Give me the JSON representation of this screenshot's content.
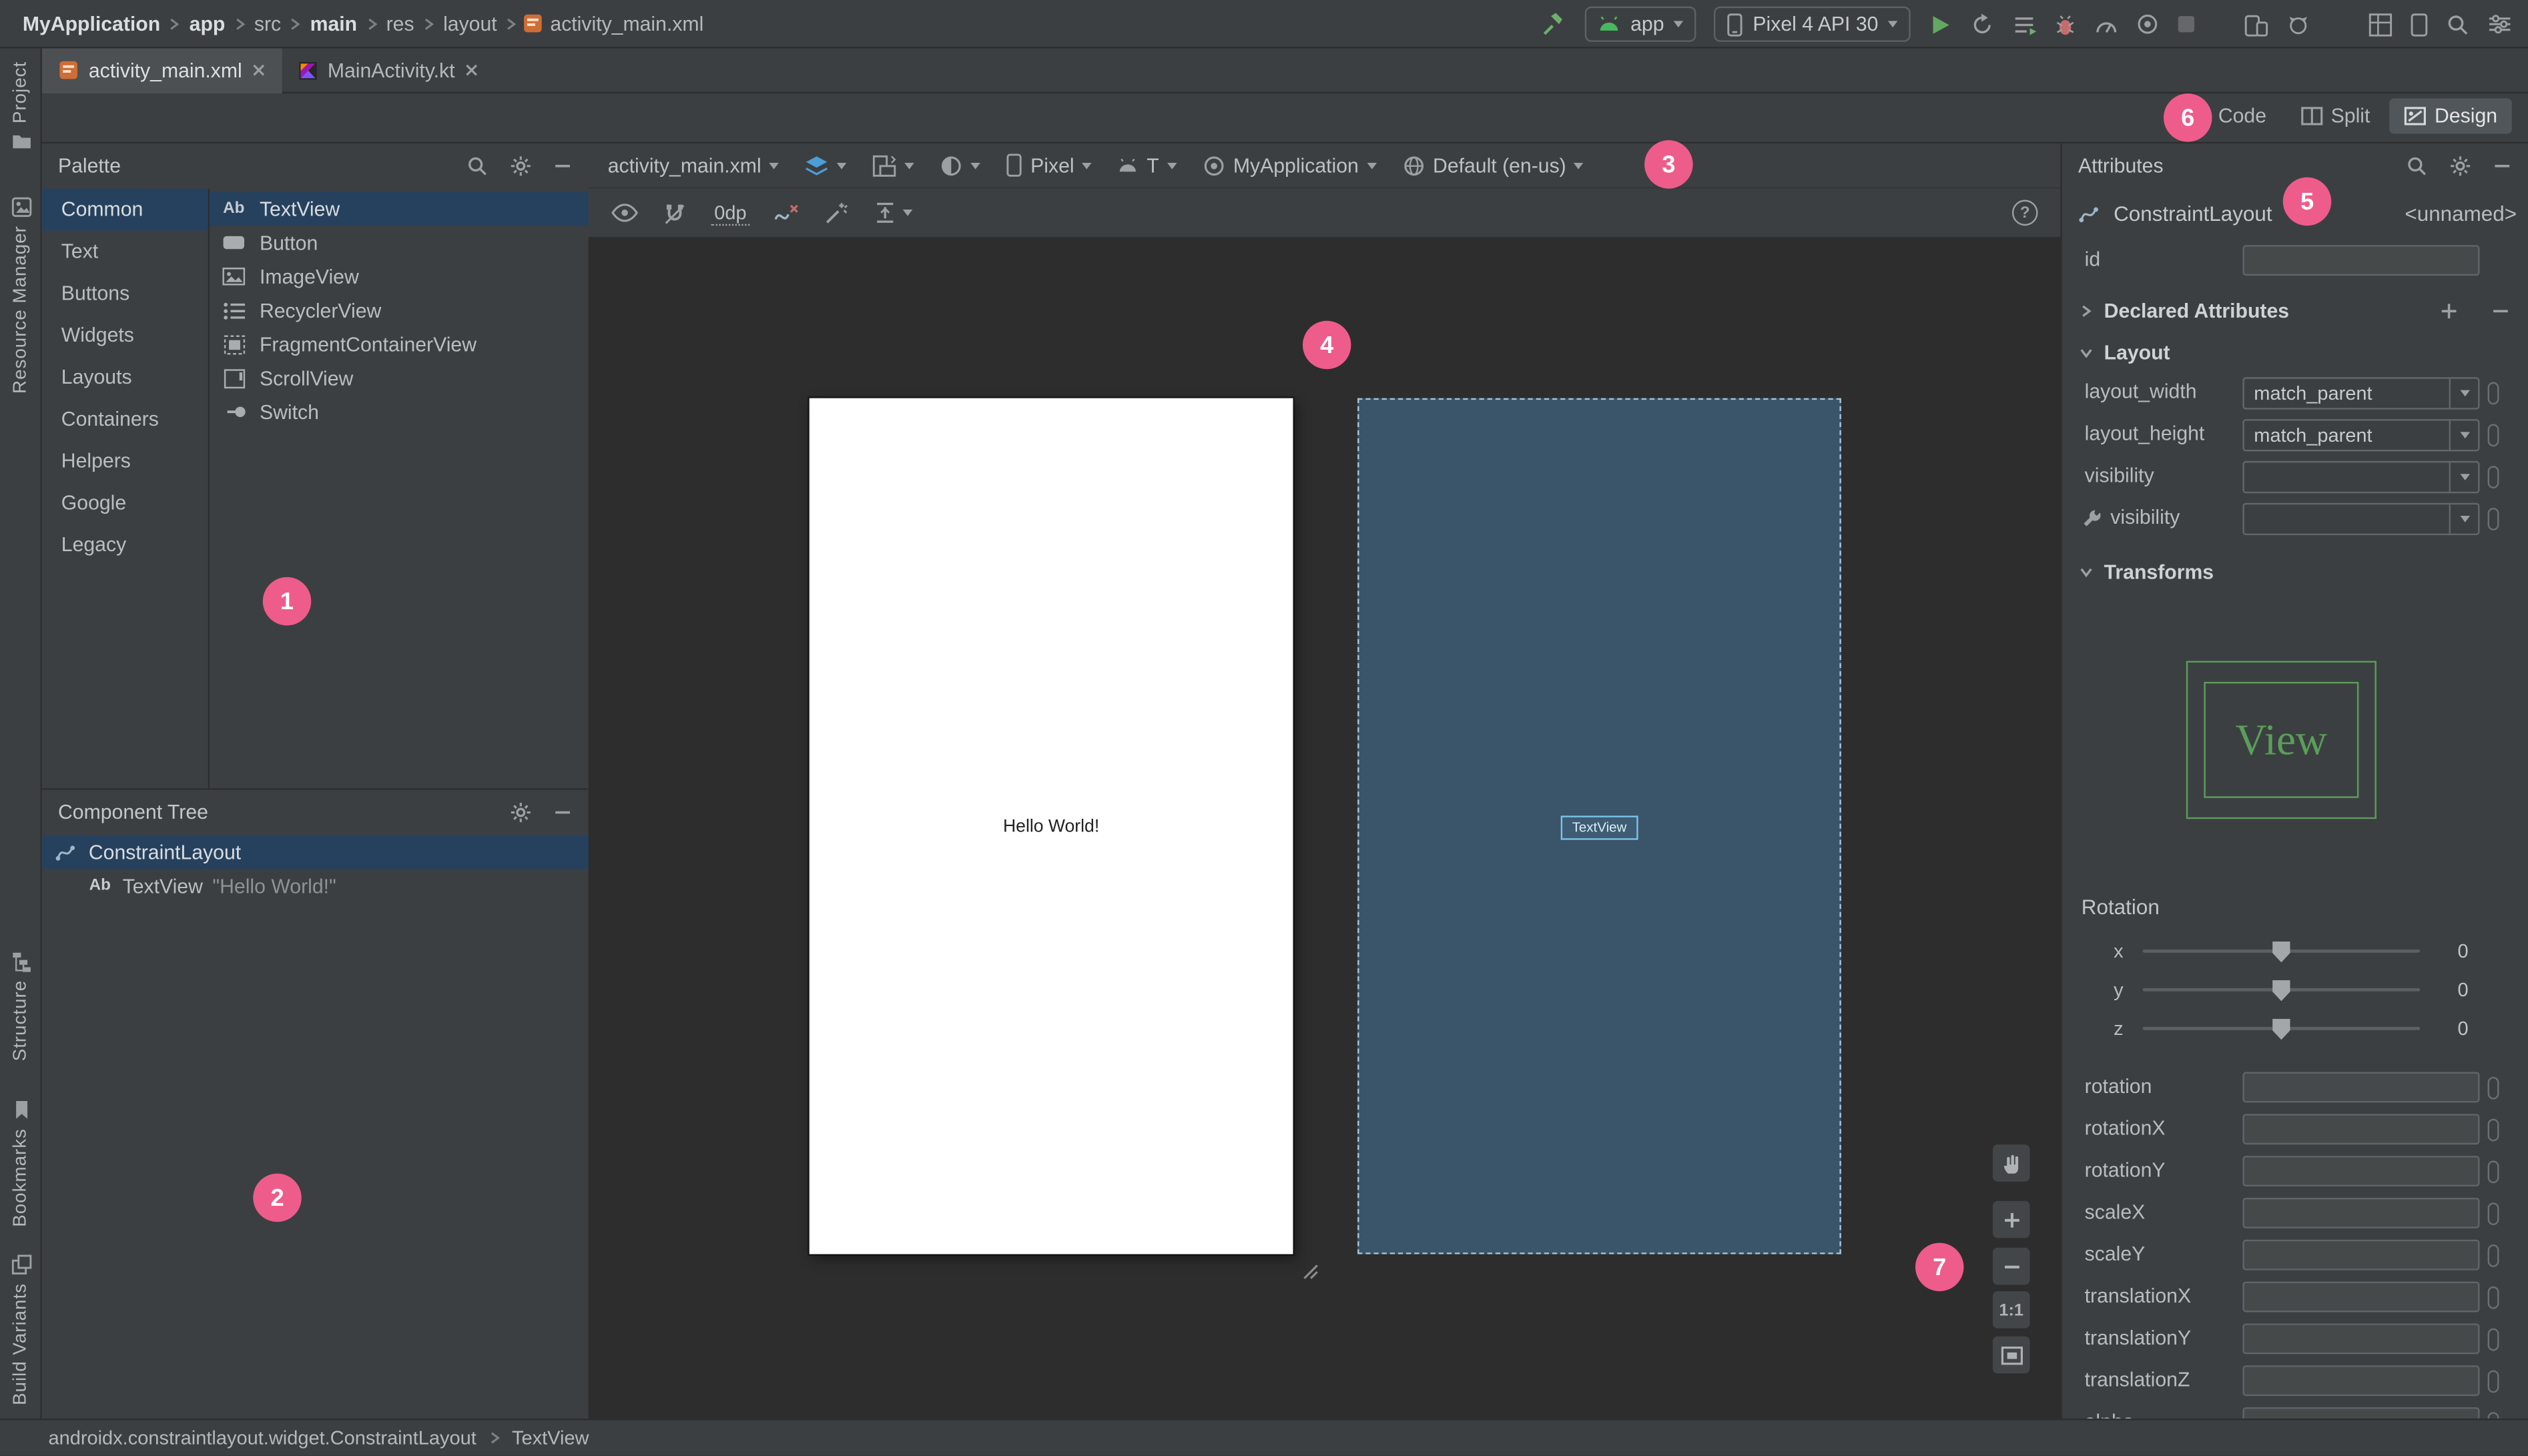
{
  "colors": {
    "badge_pink": "#ee5c8b",
    "selection_blue": "#26415e",
    "blueprint_bg": "#3a546a",
    "preview_green": "#5a9e5a"
  },
  "topbar": {
    "breadcrumb": [
      {
        "label": "MyApplication"
      },
      {
        "label": "app"
      },
      {
        "label": "src"
      },
      {
        "label": "main"
      },
      {
        "label": "res"
      },
      {
        "label": "layout"
      },
      {
        "label": "activity_main.xml"
      }
    ],
    "run_config": "app",
    "device_select": "Pixel 4 API 30"
  },
  "tabs": [
    {
      "label": "activity_main.xml"
    },
    {
      "label": "MainActivity.kt"
    }
  ],
  "modes": {
    "code": "Code",
    "split": "Split",
    "design": "Design"
  },
  "tool_windows": {
    "project": "Project",
    "resource_manager": "Resource Manager",
    "structure": "Structure",
    "bookmarks": "Bookmarks",
    "build_variants": "Build Variants"
  },
  "palette": {
    "title": "Palette",
    "categories": [
      "Common",
      "Text",
      "Buttons",
      "Widgets",
      "Layouts",
      "Containers",
      "Helpers",
      "Google",
      "Legacy"
    ],
    "components": [
      "TextView",
      "Button",
      "ImageView",
      "RecyclerView",
      "FragmentContainerView",
      "ScrollView",
      "Switch"
    ]
  },
  "component_tree": {
    "title": "Component Tree",
    "root": "ConstraintLayout",
    "child": "TextView",
    "child_value": "\"Hello World!\""
  },
  "design_toolbar": {
    "file": "activity_main.xml",
    "device": "Pixel",
    "api": "T",
    "theme": "MyApplication",
    "locale": "Default (en-us)",
    "margin": "0dp"
  },
  "surface": {
    "hello": "Hello World!",
    "widget": "TextView",
    "one_to_one": "1:1"
  },
  "icons": {
    "help": "?",
    "ab": "Ab"
  },
  "attributes": {
    "title": "Attributes",
    "component": "ConstraintLayout",
    "unnamed": "<unnamed>",
    "id_label": "id",
    "declared": "Declared Attributes",
    "layout_header": "Layout",
    "transforms_header": "Transforms",
    "layout_rows": [
      {
        "label": "layout_width",
        "value": "match_parent"
      },
      {
        "label": "layout_height",
        "value": "match_parent"
      },
      {
        "label": "visibility",
        "value": ""
      },
      {
        "label": "visibility",
        "value": ""
      }
    ],
    "preview_text": "View",
    "rotation_label": "Rotation",
    "axes": [
      {
        "axis": "x",
        "value": "0"
      },
      {
        "axis": "y",
        "value": "0"
      },
      {
        "axis": "z",
        "value": "0"
      }
    ],
    "fields": [
      "rotation",
      "rotationX",
      "rotationY",
      "scaleX",
      "scaleY",
      "translationX",
      "translationY",
      "translationZ",
      "alpha"
    ]
  },
  "status": {
    "class_name": "androidx.constraintlayout.widget.ConstraintLayout",
    "selected": "TextView"
  },
  "annotations": [
    "1",
    "2",
    "3",
    "4",
    "5",
    "6",
    "7"
  ]
}
